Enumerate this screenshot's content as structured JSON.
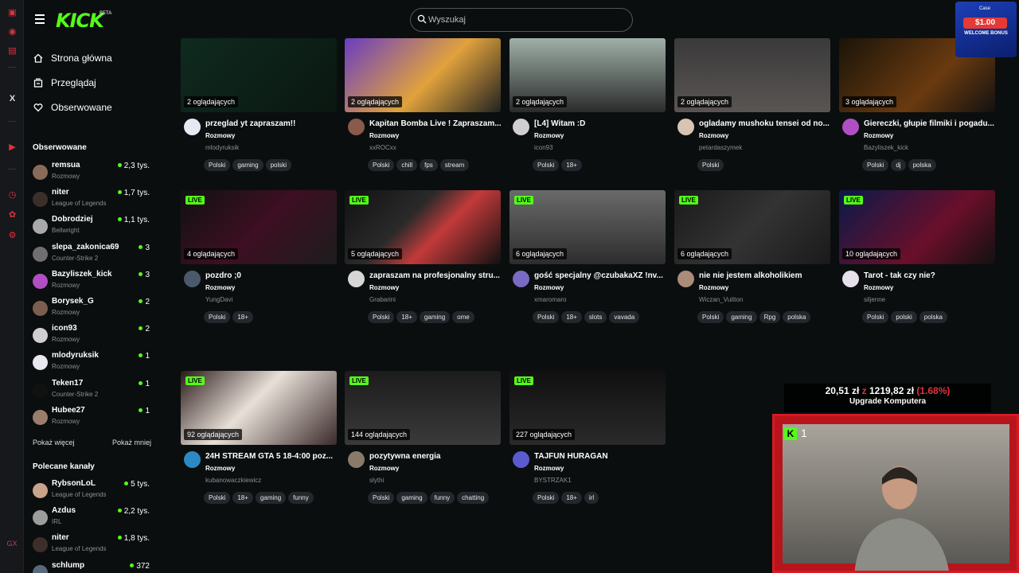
{
  "app": {
    "logo": "KICK",
    "beta": "BETA"
  },
  "search": {
    "placeholder": "Wyszukaj"
  },
  "rail": {
    "x_label": "X",
    "gx_label": "GX"
  },
  "nav": [
    {
      "label": "Strona główna",
      "icon": "home-icon"
    },
    {
      "label": "Przeglądaj",
      "icon": "browse-icon"
    },
    {
      "label": "Obserwowane",
      "icon": "heart-icon"
    }
  ],
  "followed": {
    "title": "Obserwowane",
    "channels": [
      {
        "name": "remsua",
        "category": "Rozmowy",
        "viewers": "2,3 tys.",
        "color": "#8a6b5a"
      },
      {
        "name": "niter",
        "category": "League of Legends",
        "viewers": "1,7 tys.",
        "color": "#3c2f2a"
      },
      {
        "name": "Dobrodziej",
        "category": "Bellwright",
        "viewers": "1,1 tys.",
        "color": "#a9a9a9"
      },
      {
        "name": "slepa_zakonica69",
        "category": "Counter-Strike 2",
        "viewers": "3",
        "color": "#6f6f6f"
      },
      {
        "name": "Bazyliszek_kick",
        "category": "Rozmowy",
        "viewers": "3",
        "color": "#b04fc4"
      },
      {
        "name": "Borysek_G",
        "category": "Rozmowy",
        "viewers": "2",
        "color": "#7b5e4f"
      },
      {
        "name": "icon93",
        "category": "Rozmowy",
        "viewers": "2",
        "color": "#cfcfcf"
      },
      {
        "name": "mlodyruksik",
        "category": "Rozmowy",
        "viewers": "1",
        "color": "#e8e8f0"
      },
      {
        "name": "Teken17",
        "category": "Counter-Strike 2",
        "viewers": "1",
        "color": "#111111"
      },
      {
        "name": "Hubee27",
        "category": "Rozmowy",
        "viewers": "1",
        "color": "#9a7d6a"
      }
    ],
    "show_more": "Pokaż więcej",
    "show_less": "Pokaż mniej"
  },
  "recommended": {
    "title": "Polecane kanały",
    "channels": [
      {
        "name": "RybsonLoL",
        "category": "League of Legends",
        "viewers": "5 tys.",
        "color": "#c9a38a"
      },
      {
        "name": "Azdus",
        "category": "IRL",
        "viewers": "2,2 tys.",
        "color": "#9c9c9c"
      },
      {
        "name": "niter",
        "category": "League of Legends",
        "viewers": "1,8 tys.",
        "color": "#3c2f2a"
      },
      {
        "name": "schlump",
        "category": "",
        "viewers": "372",
        "color": "#5a6a7a"
      }
    ]
  },
  "live_label": "LIVE",
  "streams": [
    {
      "viewers": "2 oglądających",
      "title": "przeglad yt zapraszam!!",
      "category": "Rozmowy",
      "user": "mlodyruksik",
      "tags": [
        "Polski",
        "gaming",
        "polski"
      ],
      "live": false,
      "bg": "linear-gradient(135deg,#0f2a1f,#0a1710)",
      "avatar": "#e8e8f0"
    },
    {
      "viewers": "2 oglądających",
      "title": "Kapitan Bomba Live ! Zapraszam...",
      "category": "Rozmowy",
      "user": "xxROCxx",
      "tags": [
        "Polski",
        "chill",
        "fps",
        "stream"
      ],
      "live": false,
      "bg": "linear-gradient(135deg,#6a3dc2,#e0a23c 55%,#222)",
      "avatar": "#8a5a4a"
    },
    {
      "viewers": "2 oglądających",
      "title": "[L4] Witam :D",
      "category": "Rozmowy",
      "user": "icon93",
      "tags": [
        "Polski",
        "18+"
      ],
      "live": false,
      "bg": "linear-gradient(180deg,#9fb0a8,#2b2b2b)",
      "avatar": "#cfcfcf"
    },
    {
      "viewers": "2 oglądających",
      "title": "ogladamy mushoku tensei od no...",
      "category": "Rozmowy",
      "user": "petardaszymek",
      "tags": [
        "Polski"
      ],
      "live": false,
      "bg": "linear-gradient(180deg,#3a3a3a,#5a5553)",
      "avatar": "#d8c4b4"
    },
    {
      "viewers": "3 oglądających",
      "title": "Giereczki, głupie filmiki i pogadu...",
      "category": "Rozmowy",
      "user": "Bazyliszek_kick",
      "tags": [
        "Polski",
        "dj",
        "polska"
      ],
      "live": false,
      "bg": "linear-gradient(135deg,#1a1408,#6a3a10 60%,#111)",
      "avatar": "#b04fc4"
    },
    {
      "viewers": "4 oglądających",
      "title": "pozdro ;0",
      "category": "Rozmowy",
      "user": "YungDavi",
      "tags": [
        "Polski",
        "18+"
      ],
      "live": true,
      "bg": "linear-gradient(135deg,#111,#3d0f22 50%,#1d1d1d)",
      "avatar": "#4a5a6a"
    },
    {
      "viewers": "5 oglądających",
      "title": "zapraszam na profesjonalny stru...",
      "category": "Rozmowy",
      "user": "Grabarini",
      "tags": [
        "Polski",
        "18+",
        "gaming",
        "ome"
      ],
      "live": true,
      "bg": "linear-gradient(135deg,#111,#2a2a2a 40%,#c23a3a 60%,#111)",
      "avatar": "#d6d6d6"
    },
    {
      "viewers": "6 oglądających",
      "title": "gość specjalny @czubakaXZ !nv...",
      "category": "Rozmowy",
      "user": "xmaromaro",
      "tags": [
        "Polski",
        "18+",
        "slots",
        "vavada"
      ],
      "live": true,
      "bg": "linear-gradient(180deg,#6a6a6a,#2d2d2d)",
      "avatar": "#7a6ac4"
    },
    {
      "viewers": "6 oglądających",
      "title": "nie nie jestem alkoholikiem",
      "category": "Rozmowy",
      "user": "Wiczan_Vuitton",
      "tags": [
        "Polski",
        "gaming",
        "Rpg",
        "polska"
      ],
      "live": true,
      "bg": "linear-gradient(135deg,#1a1a1a,#333 50%,#1a1a1a)",
      "avatar": "#aa8c7a"
    },
    {
      "viewers": "10 oglądających",
      "title": "Tarot - tak czy nie?",
      "category": "Rozmowy",
      "user": "siljenne",
      "tags": [
        "Polski",
        "polski",
        "polska"
      ],
      "live": true,
      "bg": "linear-gradient(135deg,#0a1a4a,#6a0f2a 60%,#111)",
      "avatar": "#e6e0ea"
    },
    {
      "viewers": "92 oglądających",
      "title": "24H STREAM GTA 5 18-4:00 poz...",
      "category": "Rozmowy",
      "user": "kubanowaczkiewicz",
      "tags": [
        "Polski",
        "18+",
        "gaming",
        "funny"
      ],
      "live": true,
      "bg": "linear-gradient(135deg,#2a1a1a,#e8e0d8 45%,#3a2a2a)",
      "avatar": "#2b8ac4"
    },
    {
      "viewers": "144 oglądających",
      "title": "pozytywna energia",
      "category": "Rozmowy",
      "user": "slythi",
      "tags": [
        "Polski",
        "gaming",
        "funny",
        "chatting"
      ],
      "live": true,
      "bg": "linear-gradient(180deg,#1c1c1c,#3a3a3a)",
      "avatar": "#8a7a6a"
    },
    {
      "viewers": "227 oglądających",
      "title": "TAJFUN HURAGAN",
      "category": "Rozmowy",
      "user": "BYSTRZAK1",
      "tags": [
        "Polski",
        "18+",
        "irl"
      ],
      "live": true,
      "bg": "linear-gradient(180deg,#101010,#2a2a2a)",
      "avatar": "#5b5bd0"
    }
  ],
  "overlays": {
    "promo": {
      "brand": "Case",
      "amount": "$1.00",
      "text": "WELCOME BONUS"
    },
    "donation": {
      "current": "20,51 zł",
      "sep": "z",
      "goal": "1219,82 zł",
      "pct": "(1.68%)",
      "label": "Upgrade Komputera"
    },
    "cam": {
      "count": "1"
    }
  }
}
